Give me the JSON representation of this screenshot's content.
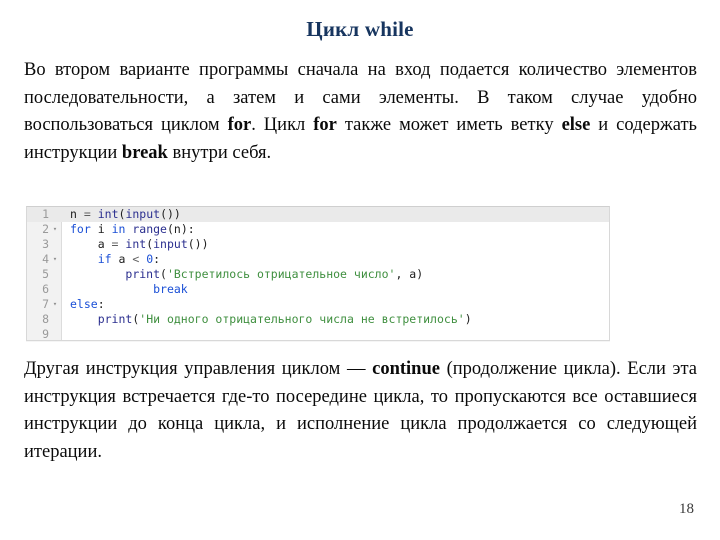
{
  "slide": {
    "title": "Цикл while",
    "page_number": "18",
    "title_color": "#17355f"
  },
  "paragraph_top": {
    "segments": [
      {
        "text": "Во втором варианте программы сначала на вход подается количество элементов последовательности, а затем и сами элементы. В таком случае удобно воспользоваться циклом ",
        "bold": false
      },
      {
        "text": "for",
        "bold": true
      },
      {
        "text": ". Цикл ",
        "bold": false
      },
      {
        "text": "for",
        "bold": true
      },
      {
        "text": " также может иметь ветку ",
        "bold": false
      },
      {
        "text": "else",
        "bold": true
      },
      {
        "text": " и содержать инструкции ",
        "bold": false
      },
      {
        "text": "break",
        "bold": true
      },
      {
        "text": " внутри себя.",
        "bold": false
      }
    ]
  },
  "paragraph_bottom": {
    "segments": [
      {
        "text": "Другая инструкция управления циклом — ",
        "bold": false
      },
      {
        "text": "continue",
        "bold": true
      },
      {
        "text": " (продолжение цикла). Если эта инструкция встречается где-то посередине цикла, то пропускаются все оставшиеся инструкции до конца цикла, и исполнение цикла продолжается со следующей итерации.",
        "bold": false
      }
    ]
  },
  "code_block": {
    "language": "python",
    "current_line": 1,
    "colors": {
      "keyword": "#1a4fd6",
      "function": "#2b2f8f",
      "string": "#3f8f3f",
      "gutter_bg": "#f2f2f2",
      "line_number": "#9a9a9a",
      "current_line_bg": "#eaeaea",
      "border": "#d8d8d8"
    },
    "lines": [
      {
        "number": "1",
        "fold": "",
        "tokens": [
          {
            "t": "n ",
            "c": "plain"
          },
          {
            "t": "= ",
            "c": "op"
          },
          {
            "t": "int",
            "c": "fn"
          },
          {
            "t": "(",
            "c": "plain"
          },
          {
            "t": "input",
            "c": "fn"
          },
          {
            "t": "())",
            "c": "plain"
          }
        ]
      },
      {
        "number": "2",
        "fold": "▾",
        "tokens": [
          {
            "t": "for",
            "c": "kw"
          },
          {
            "t": " i ",
            "c": "plain"
          },
          {
            "t": "in",
            "c": "kw"
          },
          {
            "t": " ",
            "c": "plain"
          },
          {
            "t": "range",
            "c": "fn"
          },
          {
            "t": "(n):",
            "c": "plain"
          }
        ]
      },
      {
        "number": "3",
        "fold": "",
        "tokens": [
          {
            "t": "    a ",
            "c": "plain"
          },
          {
            "t": "= ",
            "c": "op"
          },
          {
            "t": "int",
            "c": "fn"
          },
          {
            "t": "(",
            "c": "plain"
          },
          {
            "t": "input",
            "c": "fn"
          },
          {
            "t": "())",
            "c": "plain"
          }
        ]
      },
      {
        "number": "4",
        "fold": "▾",
        "tokens": [
          {
            "t": "    ",
            "c": "plain"
          },
          {
            "t": "if",
            "c": "kw"
          },
          {
            "t": " a ",
            "c": "plain"
          },
          {
            "t": "< ",
            "c": "op"
          },
          {
            "t": "0",
            "c": "num"
          },
          {
            "t": ":",
            "c": "plain"
          }
        ]
      },
      {
        "number": "5",
        "fold": "",
        "tokens": [
          {
            "t": "        ",
            "c": "plain"
          },
          {
            "t": "print",
            "c": "fn"
          },
          {
            "t": "(",
            "c": "plain"
          },
          {
            "t": "'Встретилось отрицательное число'",
            "c": "str"
          },
          {
            "t": ", a)",
            "c": "plain"
          }
        ]
      },
      {
        "number": "6",
        "fold": "",
        "tokens": [
          {
            "t": "            ",
            "c": "plain"
          },
          {
            "t": "break",
            "c": "kw"
          }
        ]
      },
      {
        "number": "7",
        "fold": "▾",
        "tokens": [
          {
            "t": "else",
            "c": "kw"
          },
          {
            "t": ":",
            "c": "plain"
          }
        ]
      },
      {
        "number": "8",
        "fold": "",
        "tokens": [
          {
            "t": "    ",
            "c": "plain"
          },
          {
            "t": "print",
            "c": "fn"
          },
          {
            "t": "(",
            "c": "plain"
          },
          {
            "t": "'Ни одного отрицательного числа не встретилось'",
            "c": "str"
          },
          {
            "t": ")",
            "c": "plain"
          }
        ]
      },
      {
        "number": "9",
        "fold": "",
        "tokens": []
      }
    ]
  }
}
